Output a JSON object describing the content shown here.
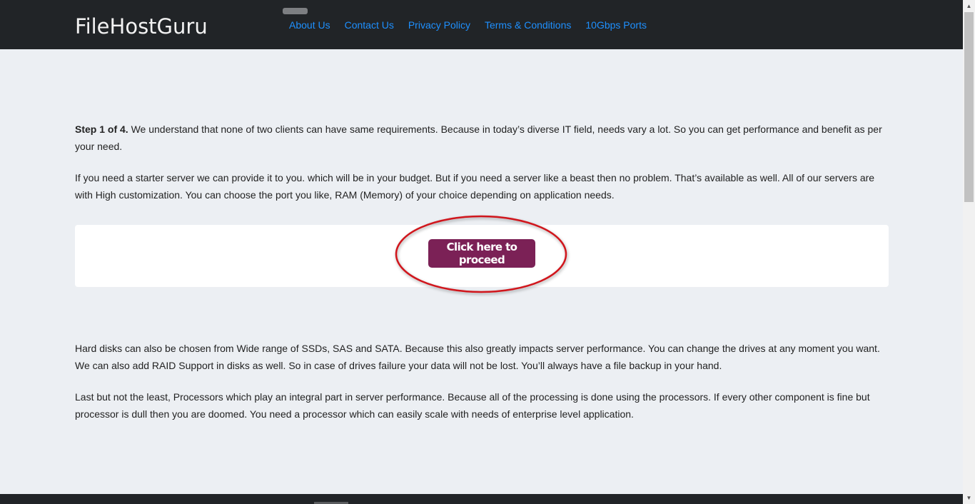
{
  "header": {
    "brand": "FileHostGuru",
    "nav_links": [
      {
        "label": "About Us"
      },
      {
        "label": "Contact Us"
      },
      {
        "label": "Privacy Policy"
      },
      {
        "label": "Terms & Conditions"
      },
      {
        "label": "10Gbps Ports"
      }
    ]
  },
  "main": {
    "step_label": "Step 1 of 4.",
    "paragraph1_text": " We understand that none of two clients can have same requirements. Because in today’s diverse IT field, needs vary a lot. So you can get performance and benefit as per your need.",
    "paragraph2": "If you need a starter server we can provide it to you. which will be in your budget. But if you need a server like a beast then no problem. That’s available as well. All of our servers are with High customization. You can choose the port you like, RAM (Memory) of your choice depending on application needs.",
    "proceed_button": "Click here to proceed",
    "paragraph3": "Hard disks can also be chosen from Wide range of SSDs, SAS and SATA. Because this also greatly impacts server performance. You can change the drives at any moment you want. We can also add RAID Support in disks as well. So in case of drives failure your data will not be lost. You’ll always have a file backup in your hand.",
    "paragraph4": "Last but not the least, Processors which play an integral part in server performance. Because all of the processing is done using the processors. If every other component is fine but processor is dull then you are doomed. You need a processor which can easily scale with needs of enterprise level application."
  },
  "colors": {
    "navbar_bg": "#212427",
    "nav_link": "#1e90ff",
    "page_bg": "#eceff3",
    "button_bg": "#7b2156",
    "highlight": "#d0141c"
  },
  "icons": {
    "scroll_up": "arrow-up-icon",
    "scroll_down": "arrow-down-icon",
    "menu_toggle": "menu-toggle-icon"
  }
}
